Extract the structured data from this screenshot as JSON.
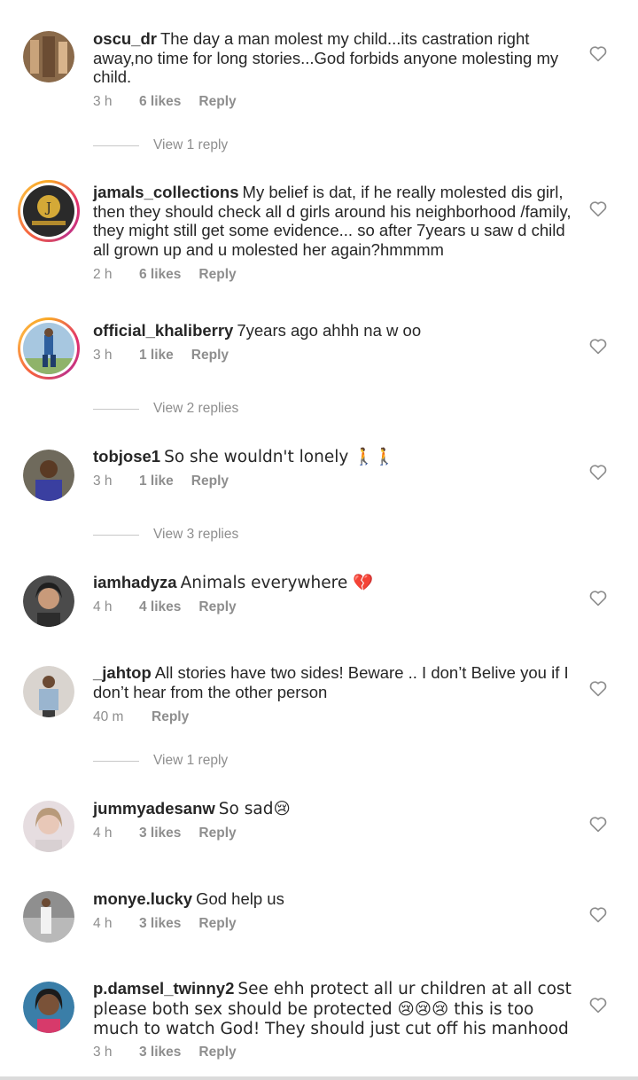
{
  "comments": [
    {
      "username": "oscu_dr",
      "text": "The day a man molest my child...its castration right away,no time for long stories...God forbids anyone molesting my child.",
      "time": "3 h",
      "likes": "6 likes",
      "reply": "Reply",
      "view_replies": "View 1 reply"
    },
    {
      "username": "jamals_collections",
      "text": "My belief is dat, if he really molested dis girl, then they should check all d girls around his neighborhood /family, they might still get some evidence... so after 7years u saw d child all grown up and u molested her again?hmmmm",
      "time": "2 h",
      "likes": "6 likes",
      "reply": "Reply"
    },
    {
      "username": "official_khaliberry",
      "text": "7years ago ahhh na w oo",
      "time": "3 h",
      "likes": "1 like",
      "reply": "Reply",
      "view_replies": "View 2 replies"
    },
    {
      "username": "tobjose1",
      "text": "So she wouldn't lonely 🚶🚶",
      "time": "3 h",
      "likes": "1 like",
      "reply": "Reply",
      "view_replies": "View 3 replies"
    },
    {
      "username": "iamhadyza",
      "text": "Animals everywhere 💔",
      "time": "4 h",
      "likes": "4 likes",
      "reply": "Reply"
    },
    {
      "username": "_jahtop",
      "text": "All stories have two sides! Beware .. I don’t Belive you if I don’t hear from the other person",
      "time": "40 m",
      "likes": "",
      "reply": "Reply",
      "view_replies": "View 1 reply"
    },
    {
      "username": "jummyadesanw",
      "text": "So sad😢",
      "time": "4 h",
      "likes": "3 likes",
      "reply": "Reply"
    },
    {
      "username": "monye.lucky",
      "text": "God help us",
      "time": "4 h",
      "likes": "3 likes",
      "reply": "Reply"
    },
    {
      "username": "p.damsel_twinny2",
      "text": "See ehh protect all ur children at all cost please both sex should be protected 😢😢😢 this is too much to watch God! They should just cut off his manhood",
      "time": "3 h",
      "likes": "3 likes",
      "reply": "Reply"
    }
  ],
  "icons": {
    "like": "heart-outline-icon",
    "avatar_ring": "story-ring"
  },
  "colors": {
    "text": "#262626",
    "meta": "#8e8e8e",
    "ring_start": "#f9a825",
    "ring_end": "#c13584"
  }
}
